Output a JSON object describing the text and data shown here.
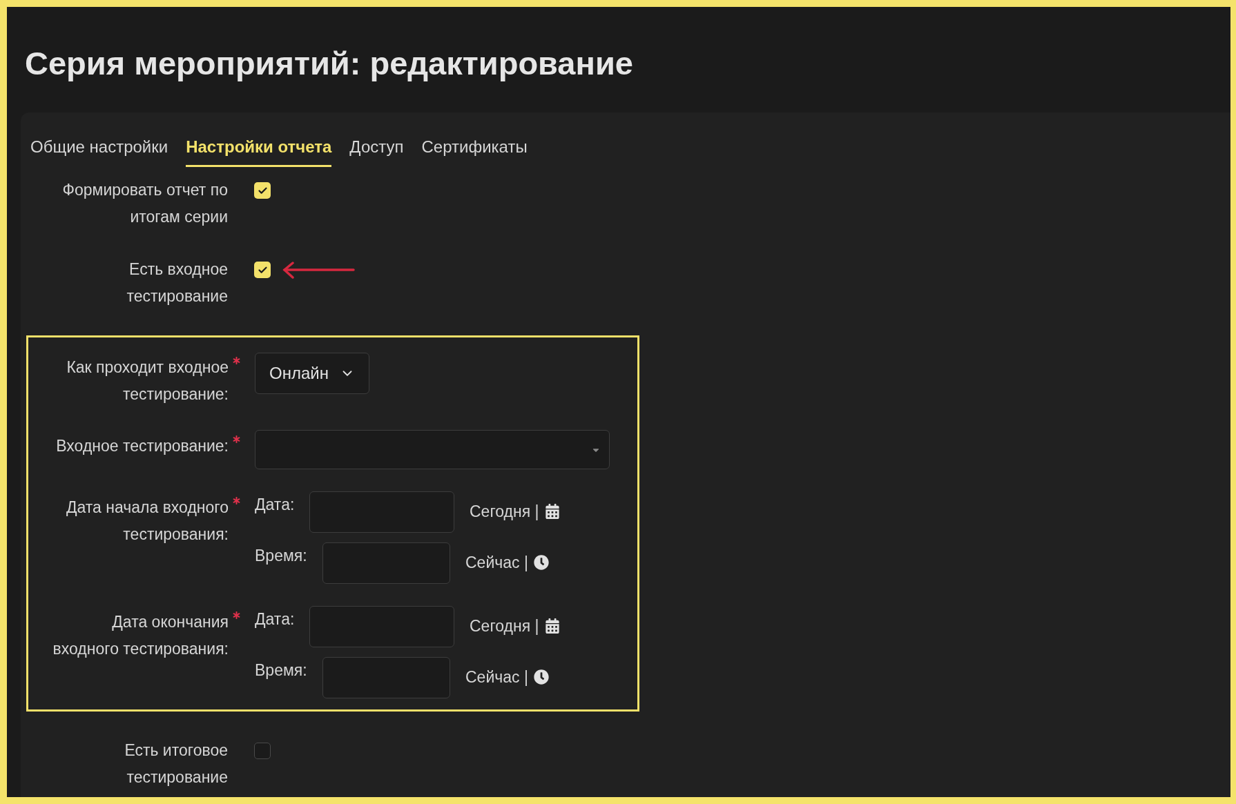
{
  "title": "Серия мероприятий: редактирование",
  "tabs": [
    {
      "label": "Общие настройки",
      "selected": false
    },
    {
      "label": "Настройки отчета",
      "selected": true
    },
    {
      "label": "Доступ",
      "selected": false
    },
    {
      "label": "Сертификаты",
      "selected": false
    }
  ],
  "fields": [
    {
      "kind": "checkbox",
      "label": "Формировать отчет по итогам серии",
      "checked": true,
      "arrow": false
    },
    {
      "kind": "checkbox",
      "label": "Есть входное тестирование",
      "checked": true,
      "arrow": true
    },
    {
      "kind": "group",
      "highlighted": true,
      "fields": [
        {
          "kind": "select",
          "label": "Как проходит входное тестирование:",
          "required": true,
          "value": "Онлайн"
        },
        {
          "kind": "combobox",
          "label": "Входное тестирование:",
          "required": true
        },
        {
          "kind": "datetime",
          "label": "Дата начала входного тестирования:",
          "required": true,
          "date_label": "Дата:",
          "today_label": "Сегодня |",
          "time_label": "Время:",
          "now_label": "Сейчас |"
        },
        {
          "kind": "datetime",
          "label": "Дата окончания входного тестирования:",
          "required": true,
          "date_label": "Дата:",
          "today_label": "Сегодня |",
          "time_label": "Время:",
          "now_label": "Сейчас |"
        }
      ]
    },
    {
      "kind": "checkbox",
      "label": "Есть итоговое тестирование",
      "checked": false,
      "arrow": false
    }
  ]
}
